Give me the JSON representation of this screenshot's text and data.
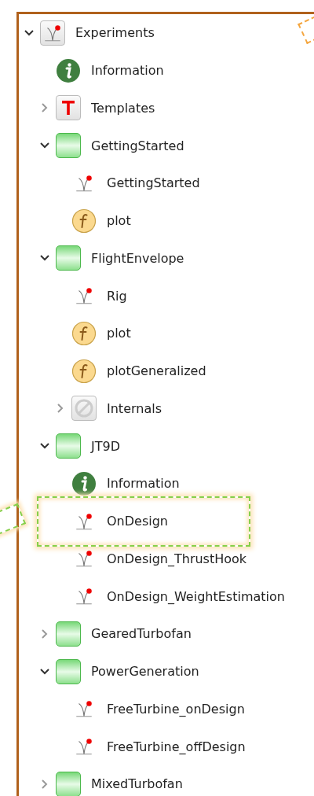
{
  "tree": [
    {
      "kind": "experiment",
      "label": "Experiments",
      "expanded": true,
      "children": [
        {
          "kind": "info",
          "label": "Information"
        },
        {
          "kind": "template",
          "label": "Templates",
          "expanded": false
        },
        {
          "kind": "folder",
          "label": "GettingStarted",
          "expanded": true,
          "children": [
            {
              "kind": "script",
              "label": "GettingStarted"
            },
            {
              "kind": "function",
              "label": "plot"
            }
          ]
        },
        {
          "kind": "folder",
          "label": "FlightEnvelope",
          "expanded": true,
          "children": [
            {
              "kind": "script",
              "label": "Rig"
            },
            {
              "kind": "function",
              "label": "plot"
            },
            {
              "kind": "function",
              "label": "plotGeneralized"
            },
            {
              "kind": "internals",
              "label": "Internals",
              "expanded": false
            }
          ]
        },
        {
          "kind": "folder",
          "label": "JT9D",
          "expanded": true,
          "children": [
            {
              "kind": "info",
              "label": "Information"
            },
            {
              "kind": "script",
              "label": "OnDesign",
              "highlighted": true
            },
            {
              "kind": "script",
              "label": "OnDesign_ThrustHook"
            },
            {
              "kind": "script",
              "label": "OnDesign_WeightEstimation"
            }
          ]
        },
        {
          "kind": "folder",
          "label": "GearedTurbofan",
          "expanded": false
        },
        {
          "kind": "folder",
          "label": "PowerGeneration",
          "expanded": true,
          "children": [
            {
              "kind": "script",
              "label": "FreeTurbine_onDesign"
            },
            {
              "kind": "script",
              "label": "FreeTurbine_offDesign"
            }
          ]
        },
        {
          "kind": "folder",
          "label": "MixedTurbofan",
          "expanded": false
        }
      ]
    }
  ]
}
